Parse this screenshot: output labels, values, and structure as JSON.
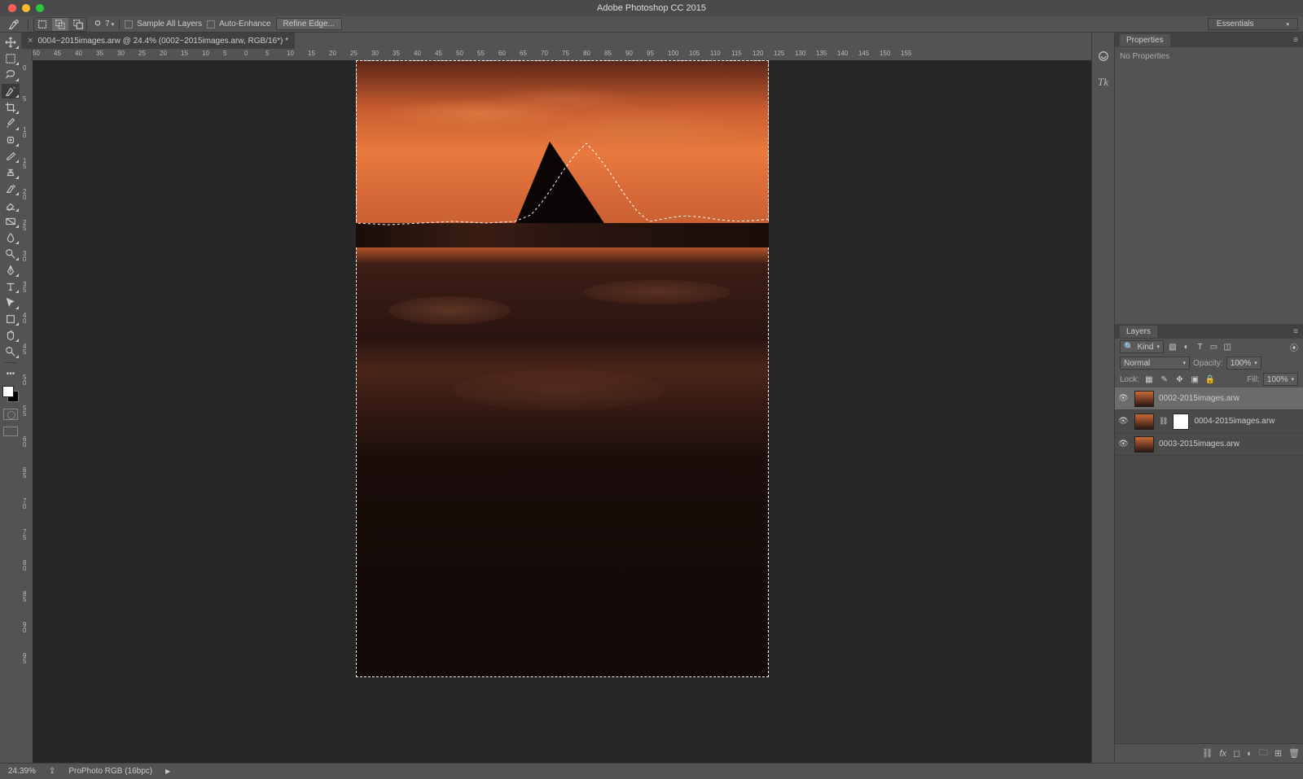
{
  "app": {
    "title": "Adobe Photoshop CC 2015"
  },
  "options": {
    "size_value": "7",
    "sample_all_layers": "Sample All Layers",
    "auto_enhance": "Auto-Enhance",
    "refine_edge": "Refine Edge...",
    "workspace": "Essentials"
  },
  "document": {
    "tab_title": "0004~2015images.arw @ 24.4% (0002~2015images.arw, RGB/16*) *",
    "tab_close": "×"
  },
  "ruler_h": [
    "50",
    "45",
    "40",
    "35",
    "30",
    "25",
    "20",
    "15",
    "10",
    "5",
    "0",
    "5",
    "10",
    "15",
    "20",
    "25",
    "30",
    "35",
    "40",
    "45",
    "50",
    "55",
    "60",
    "65",
    "70",
    "75",
    "80",
    "85",
    "90",
    "95",
    "100",
    "105",
    "110",
    "115",
    "120",
    "125",
    "130",
    "135",
    "140",
    "145",
    "150",
    "155"
  ],
  "ruler_v": [
    "0",
    "5",
    "1\n0",
    "1\n5",
    "2\n0",
    "2\n5",
    "3\n0",
    "3\n5",
    "4\n0",
    "4\n5",
    "5\n0",
    "5\n5",
    "6\n0",
    "6\n5",
    "7\n0",
    "7\n5",
    "8\n0",
    "8\n5",
    "9\n0",
    "9\n5"
  ],
  "properties": {
    "title": "Properties",
    "body": "No Properties"
  },
  "layers": {
    "title": "Layers",
    "filter_kind": "Kind",
    "blend_mode": "Normal",
    "opacity_label": "Opacity:",
    "opacity_value": "100%",
    "lock_label": "Lock:",
    "fill_label": "Fill:",
    "fill_value": "100%",
    "items": [
      {
        "name": "0002-2015images.arw",
        "has_mask": false
      },
      {
        "name": "0004-2015images.arw",
        "has_mask": true
      },
      {
        "name": "0003-2015images.arw",
        "has_mask": false
      }
    ]
  },
  "status": {
    "zoom": "24.39%",
    "profile": "ProPhoto RGB (16bpc)"
  }
}
